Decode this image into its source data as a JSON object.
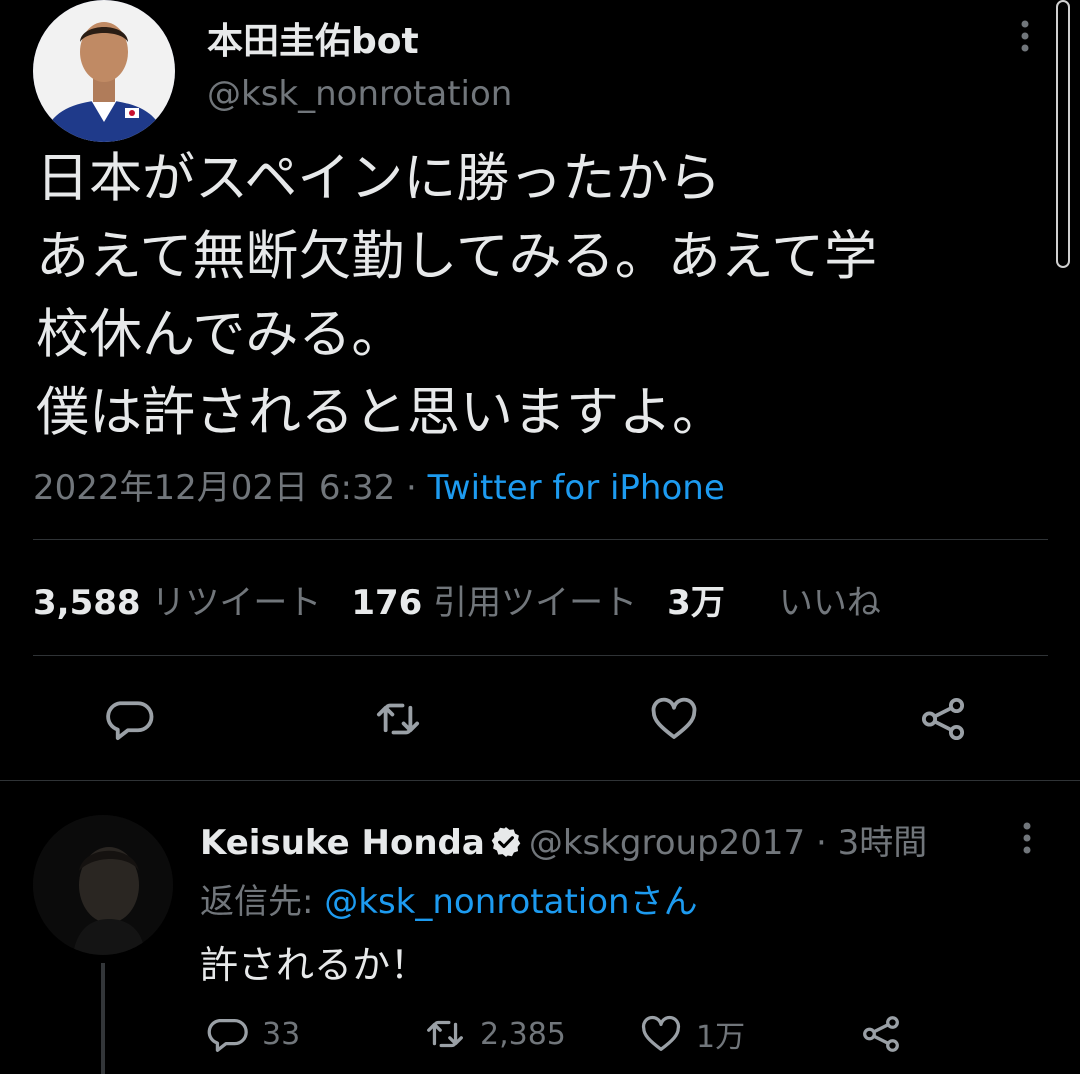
{
  "tweet": {
    "display_name": "本田圭佑bot",
    "handle": "@ksk_nonrotation",
    "text_lines": [
      "日本がスペインに勝ったから",
      "あえて無断欠勤してみる。あえて学",
      "校休んでみる。",
      "僕は許されると思いますよ。"
    ],
    "timestamp": "2022年12月02日 6:32",
    "separator": " · ",
    "source": "Twitter for iPhone"
  },
  "stats": {
    "retweets_count": "3,588",
    "retweets_label": "リツイート",
    "quotes_count": "176",
    "quotes_label": "引用ツイート",
    "likes_count": "3万",
    "likes_label": "いいね"
  },
  "actions": {
    "icons": [
      "reply-icon",
      "retweet-icon",
      "like-icon",
      "share-icon"
    ]
  },
  "reply": {
    "display_name": "Keisuke Honda",
    "handle": "@kskgroup2017",
    "separator": " · ",
    "time": "3時間",
    "replying_to_label": "返信先: ",
    "replying_to_handle": "@ksk_nonrotation",
    "replying_to_suffix": "さん",
    "text": "許されるか！",
    "reply_count": "33",
    "retweet_count": "2,385",
    "like_count": "1万"
  },
  "colors": {
    "background": "#000000",
    "text_primary": "#e7e9ea",
    "text_secondary": "#71767b",
    "accent": "#1d9bf0",
    "divider": "#2f3336"
  }
}
